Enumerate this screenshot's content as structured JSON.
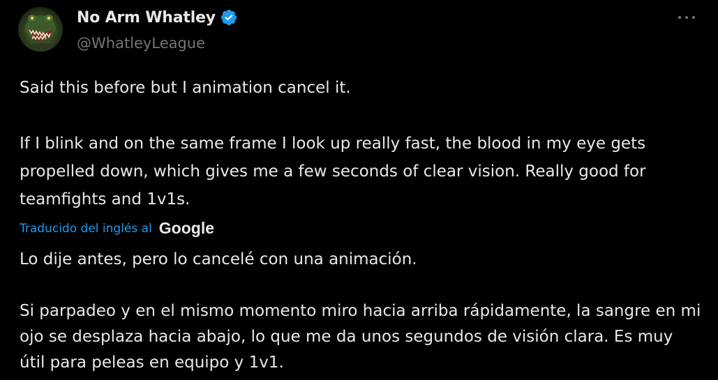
{
  "author": {
    "display_name": "No Arm Whatley",
    "handle": "@WhatleyLeague",
    "verified": true,
    "avatar_icon": "crocodile-avatar-icon"
  },
  "tweet": {
    "text": "Said this before but I animation cancel it.\n\nIf I blink and on the same frame I look up really fast, the blood in my eye gets propelled down, which gives me a few seconds of clear vision. Really good for teamfights and 1v1s."
  },
  "translation": {
    "label": "Traducido del inglés al",
    "provider": "Google",
    "text": "Lo dije antes, pero lo cancelé con una animación.\n\nSi parpadeo y en el mismo momento miro hacia arriba rápidamente, la sangre en mi ojo se desplaza hacia abajo, lo que me da unos segundos de visión clara. Es muy útil para peleas en equipo y 1v1."
  },
  "colors": {
    "background": "#000000",
    "text": "#e7e9ea",
    "secondary_text": "#71767b",
    "accent": "#1d9bf0"
  }
}
